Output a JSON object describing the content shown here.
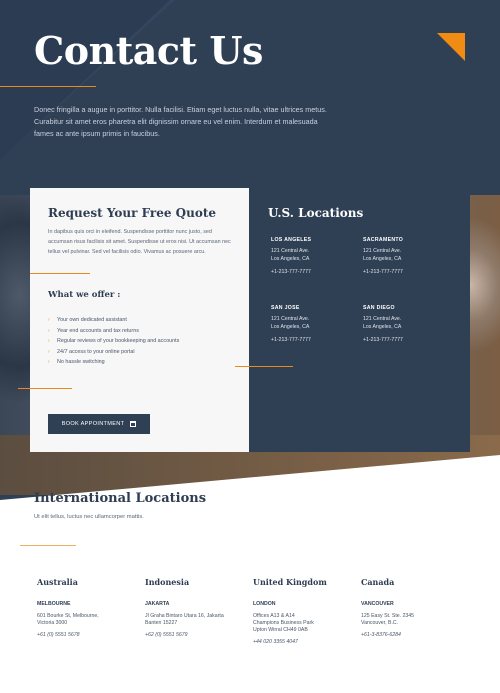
{
  "header": {
    "title": "Contact Us",
    "intro": "Donec fringilla a augue in porttitor. Nulla facilisi. Etiam eget luctus nulla, vitae ultrices metus. Curabitur sit amet eros pharetra elit dignissim ornare eu vel enim. Interdum et malesuada fames ac ante ipsum primis in faucibus."
  },
  "quote": {
    "title": "Request Your Free Quote",
    "text": "In dapibus quis orci in eleifend. Suspendisse porttitor nunc justo, sed accumsan risus facilisis sit amet. Suspendisse ut eros nisi. Ut accumsan nec tellus vel pulvinar. Sed vel facilisis odio. Vivamus ac posuere arcu.",
    "offer_title": "What we offer :",
    "offers": [
      "Your own dedicated assistant",
      "Year end accounts and tax returns",
      "Regular reviews of your bookkeeping and accounts",
      "24/7 access to your online portal",
      "No hassle switching"
    ],
    "button_label": "BOOK APPOINTMENT",
    "button_icon": "calendar-icon"
  },
  "us": {
    "title": "U.S. Locations",
    "locations": [
      {
        "city": "LOS ANGELES",
        "addr1": "121 Central Ave.",
        "addr2": "Los Angeles, CA",
        "phone": "+1-213-777-7777"
      },
      {
        "city": "SACRAMENTO",
        "addr1": "121 Central Ave.",
        "addr2": "Los Angeles, CA",
        "phone": "+1-213-777-7777"
      },
      {
        "city": "SAN JOSE",
        "addr1": "121 Central Ave.",
        "addr2": "Los Angeles, CA",
        "phone": "+1-213-777-7777"
      },
      {
        "city": "SAN DIEGO",
        "addr1": "121 Central Ave.",
        "addr2": "Los Angeles, CA",
        "phone": "+1-213-777-7777"
      }
    ]
  },
  "international": {
    "title": "International Locations",
    "subtitle": "Ut elit tellus, luctus nec ullamcorper mattis.",
    "countries": [
      {
        "name": "Australia",
        "city": "MELBOURNE",
        "addr1": "601 Bourke St, Melbourne,",
        "addr2": "Victoria 3000",
        "addr3": "",
        "phone": "+61 (0) 5551 5678"
      },
      {
        "name": "Indonesia",
        "city": "JAKARTA",
        "addr1": "Jl Graha Bintaro Utara 16, Jakarta",
        "addr2": "Banten 15227",
        "addr3": "",
        "phone": "+62 (0) 5551 5679"
      },
      {
        "name": "United Kingdom",
        "city": "LONDON",
        "addr1": "Offices A13 & A14",
        "addr2": "Champions Business Park",
        "addr3": "Upton Wirral CH49 0AB",
        "phone": "+44 020 3355 4047"
      },
      {
        "name": "Canada",
        "city": "VANCOUVER",
        "addr1": "125 Easy St. Ste. 2345",
        "addr2": "Vancouver, B.C.",
        "addr3": "",
        "phone": "+61-3-8376-6284"
      }
    ]
  },
  "colors": {
    "navy": "#2f3f54",
    "accent": "#f08c14",
    "card": "#f7f7f7"
  }
}
